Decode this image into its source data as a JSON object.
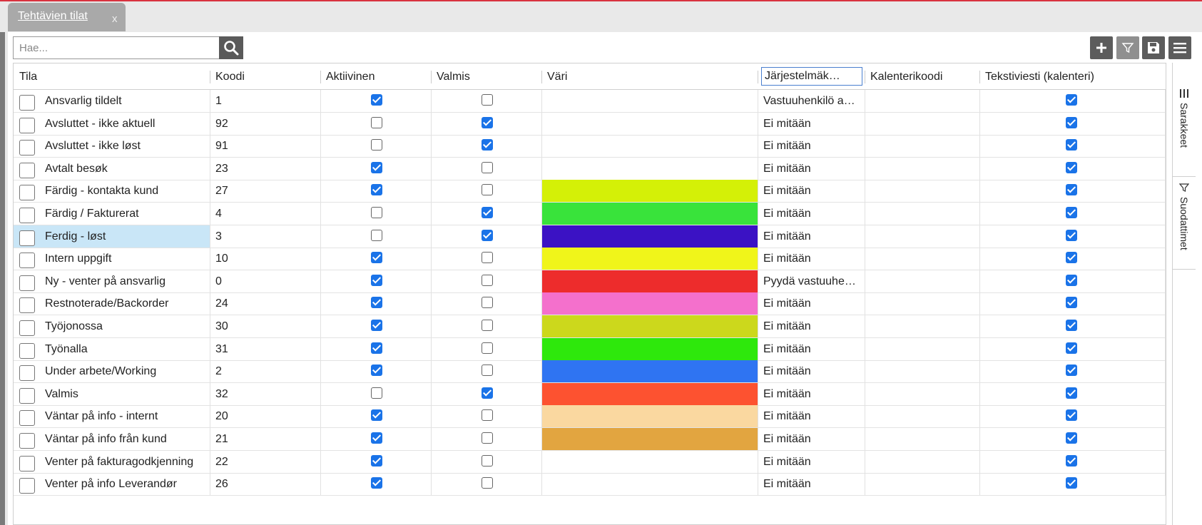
{
  "tab": {
    "title": "Tehtävien tilat",
    "close": "x"
  },
  "search": {
    "placeholder": "Hae...",
    "value": ""
  },
  "toolbar": {
    "icons": [
      "plus-icon",
      "filter-icon",
      "save-icon",
      "menu-icon"
    ]
  },
  "columns": {
    "tila": "Tila",
    "koodi": "Koodi",
    "aktiivinen": "Aktiivinen",
    "valmis": "Valmis",
    "vari": "Väri",
    "jarjestelma": "Järjestelmäk…",
    "kalenterikoodi": "Kalenterikoodi",
    "tekstiviesti": "Tekstiviesti (kalenteri)"
  },
  "side_tabs": {
    "columns": "Sarakkeet",
    "filters": "Suodattimet"
  },
  "rows": [
    {
      "tila": "Ansvarlig tildelt",
      "koodi": "1",
      "aktiivinen": true,
      "valmis": false,
      "color": "",
      "jarjestelma": "Vastuuhenkilö a…",
      "kalenterikoodi": "",
      "tekstiviesti": true
    },
    {
      "tila": "Avsluttet - ikke aktuell",
      "koodi": "92",
      "aktiivinen": false,
      "valmis": true,
      "color": "",
      "jarjestelma": "Ei mitään",
      "kalenterikoodi": "",
      "tekstiviesti": true
    },
    {
      "tila": "Avsluttet - ikke løst",
      "koodi": "91",
      "aktiivinen": false,
      "valmis": true,
      "color": "",
      "jarjestelma": "Ei mitään",
      "kalenterikoodi": "",
      "tekstiviesti": true
    },
    {
      "tila": "Avtalt besøk",
      "koodi": "23",
      "aktiivinen": true,
      "valmis": false,
      "color": "",
      "jarjestelma": "Ei mitään",
      "kalenterikoodi": "",
      "tekstiviesti": true
    },
    {
      "tila": "Färdig - kontakta kund",
      "koodi": "27",
      "aktiivinen": true,
      "valmis": false,
      "color": "#d4f007",
      "jarjestelma": "Ei mitään",
      "kalenterikoodi": "",
      "tekstiviesti": true
    },
    {
      "tila": "Färdig / Fakturerat",
      "koodi": "4",
      "aktiivinen": false,
      "valmis": true,
      "color": "#39e33b",
      "jarjestelma": "Ei mitään",
      "kalenterikoodi": "",
      "tekstiviesti": true
    },
    {
      "tila": "Ferdig - løst",
      "koodi": "3",
      "aktiivinen": false,
      "valmis": true,
      "color": "#3b12c4",
      "jarjestelma": "Ei mitään",
      "kalenterikoodi": "",
      "tekstiviesti": true,
      "selected": true
    },
    {
      "tila": "Intern uppgift",
      "koodi": "10",
      "aktiivinen": true,
      "valmis": false,
      "color": "#f0f51a",
      "jarjestelma": "Ei mitään",
      "kalenterikoodi": "",
      "tekstiviesti": true
    },
    {
      "tila": "Ny - venter på ansvarlig",
      "koodi": "0",
      "aktiivinen": true,
      "valmis": false,
      "color": "#ed2c2c",
      "jarjestelma": "Pyydä vastuuhe…",
      "kalenterikoodi": "",
      "tekstiviesti": true
    },
    {
      "tila": "Restnoterade/Backorder",
      "koodi": "24",
      "aktiivinen": true,
      "valmis": false,
      "color": "#f470cc",
      "jarjestelma": "Ei mitään",
      "kalenterikoodi": "",
      "tekstiviesti": true
    },
    {
      "tila": "Työjonossa",
      "koodi": "30",
      "aktiivinen": true,
      "valmis": false,
      "color": "#ccd81c",
      "jarjestelma": "Ei mitään",
      "kalenterikoodi": "",
      "tekstiviesti": true
    },
    {
      "tila": "Työnalla",
      "koodi": "31",
      "aktiivinen": true,
      "valmis": false,
      "color": "#2ee80c",
      "jarjestelma": "Ei mitään",
      "kalenterikoodi": "",
      "tekstiviesti": true
    },
    {
      "tila": "Under arbete/Working",
      "koodi": "2",
      "aktiivinen": true,
      "valmis": false,
      "color": "#2f74f2",
      "jarjestelma": "Ei mitään",
      "kalenterikoodi": "",
      "tekstiviesti": true
    },
    {
      "tila": "Valmis",
      "koodi": "32",
      "aktiivinen": false,
      "valmis": true,
      "color": "#fd5230",
      "jarjestelma": "Ei mitään",
      "kalenterikoodi": "",
      "tekstiviesti": true
    },
    {
      "tila": "Väntar på info - internt",
      "koodi": "20",
      "aktiivinen": true,
      "valmis": false,
      "color": "#fad8a0",
      "jarjestelma": "Ei mitään",
      "kalenterikoodi": "",
      "tekstiviesti": true
    },
    {
      "tila": "Väntar på info från kund",
      "koodi": "21",
      "aktiivinen": true,
      "valmis": false,
      "color": "#e2a540",
      "jarjestelma": "Ei mitään",
      "kalenterikoodi": "",
      "tekstiviesti": true
    },
    {
      "tila": "Venter på fakturagodkjenning",
      "koodi": "22",
      "aktiivinen": true,
      "valmis": false,
      "color": "",
      "jarjestelma": "Ei mitään",
      "kalenterikoodi": "",
      "tekstiviesti": true
    },
    {
      "tila": "Venter på info Leverandør",
      "koodi": "26",
      "aktiivinen": true,
      "valmis": false,
      "color": "",
      "jarjestelma": "Ei mitään",
      "kalenterikoodi": "",
      "tekstiviesti": true
    }
  ]
}
